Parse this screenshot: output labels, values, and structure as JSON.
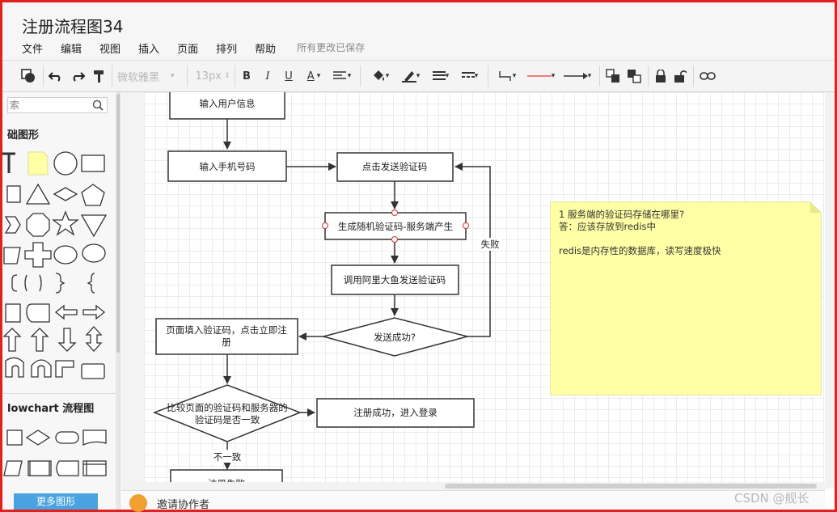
{
  "app": {
    "title": "注册流程图34",
    "menu": [
      "文件",
      "编辑",
      "视图",
      "插入",
      "页面",
      "排列",
      "帮助"
    ],
    "save_status": "所有更改已保存"
  },
  "toolbar": {
    "font_name": "微软雅黑",
    "font_size": "13px",
    "bold": "B",
    "italic": "I",
    "underline": "U",
    "font_color": "A"
  },
  "sidebar": {
    "search_placeholder": "索",
    "basic_title": "础图形",
    "flowchart_title": "lowchart 流程图",
    "more_button": "更多图形"
  },
  "flowchart": {
    "nodes": {
      "input_user_info": "输入用户信息",
      "input_phone": "输入手机号码",
      "click_send_code": "点击发送验证码",
      "gen_random_code": "生成随机验证码-服务端产生",
      "call_aliyun": "调用阿里大鱼发送验证码",
      "send_success": "发送成功?",
      "fill_code_line1": "页面填入验证码，点击立即注",
      "fill_code_line2": "册",
      "compare_line1": "比较页面的验证码和服务器的",
      "compare_line2": "验证码是否一致",
      "register_success": "注册成功，进入登录",
      "bottom_box": "注册失败"
    },
    "edges": {
      "fail": "失败",
      "mismatch": "不一致"
    }
  },
  "note": {
    "line1": "1 服务端的验证码存储在哪里?",
    "line2": "答：应该存放到redis中",
    "line3": "redis是内存性的数据库，读写速度极快"
  },
  "bottom": {
    "invite": "邀请协作者"
  },
  "watermark": "CSDN @舰长",
  "colors": {
    "frame": "#e2211c",
    "note": "#ffffa6",
    "button": "#4aa3df"
  }
}
